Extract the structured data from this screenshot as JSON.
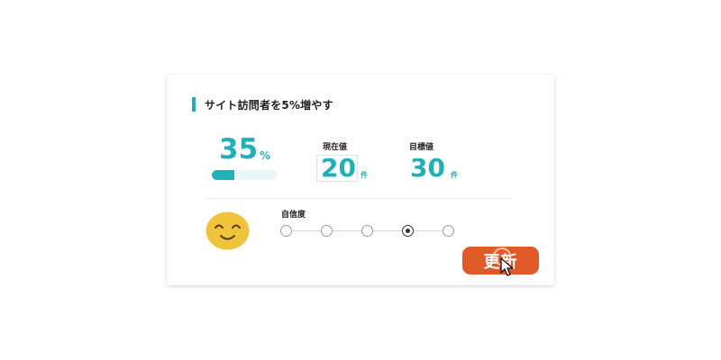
{
  "card": {
    "title": "サイト訪問者を5%増やす"
  },
  "progress": {
    "value_text": "35",
    "unit": "%",
    "fraction": 0.35
  },
  "current": {
    "label": "現在値",
    "value": "20",
    "unit": "件"
  },
  "target": {
    "label": "目標値",
    "value": "30",
    "unit": "件"
  },
  "confidence": {
    "label": "自信度",
    "levels": 5,
    "selected_index": 3
  },
  "mood_icon": "smiling-face-icon",
  "buttons": {
    "update": "更新"
  },
  "colors": {
    "accent": "#22b0b8",
    "button": "#df5a28",
    "smiley": "#f0c33c"
  }
}
